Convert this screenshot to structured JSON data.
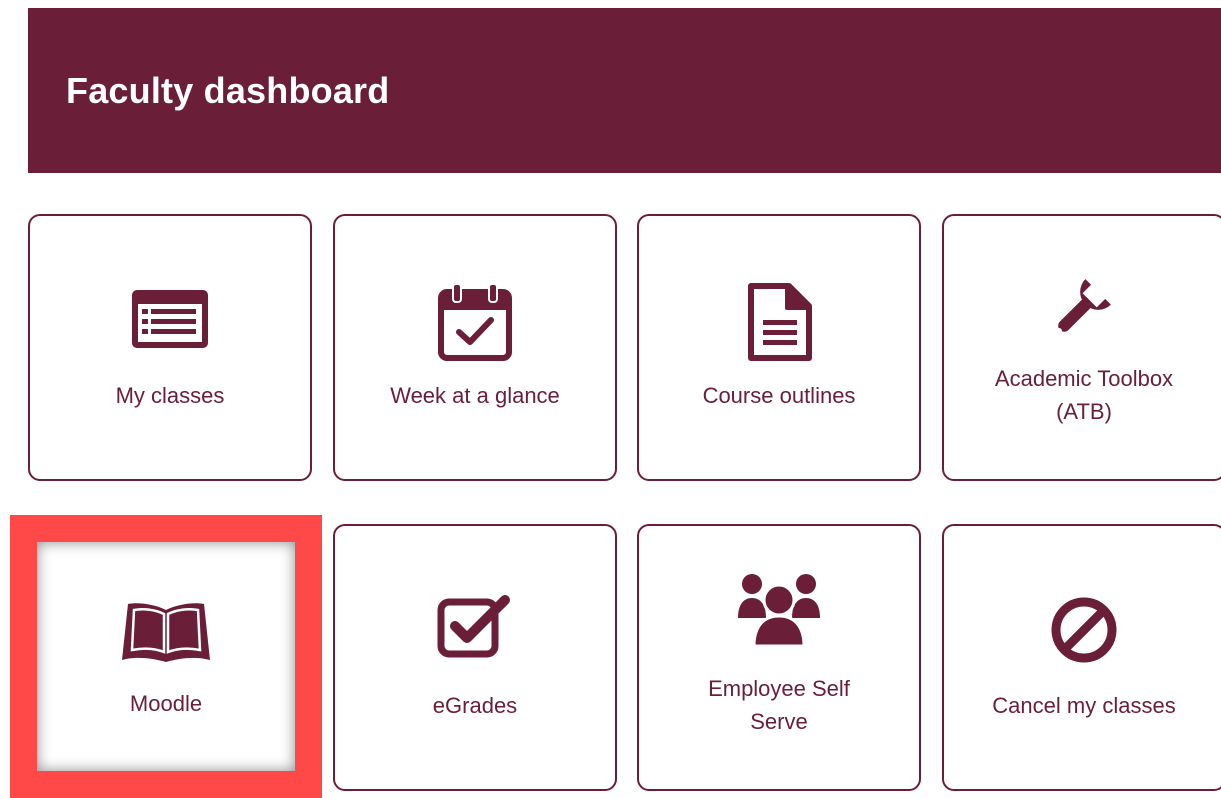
{
  "header": {
    "title": "Faculty dashboard",
    "background_color": "#6a1e37"
  },
  "tiles": [
    {
      "label": "My classes",
      "icon": "list-card-icon"
    },
    {
      "label": "Week at a glance",
      "icon": "calendar-check-icon"
    },
    {
      "label": "Course outlines",
      "icon": "document-icon"
    },
    {
      "label": "Academic Toolbox\n(ATB)",
      "icon": "wrench-icon"
    },
    {
      "label": "Moodle",
      "icon": "open-book-icon",
      "highlighted": true
    },
    {
      "label": "eGrades",
      "icon": "checkbox-icon"
    },
    {
      "label": "Employee Self\nServe",
      "icon": "people-group-icon"
    },
    {
      "label": "Cancel my classes",
      "icon": "prohibited-icon"
    }
  ],
  "colors": {
    "accent": "#6a1e37",
    "highlight": "#ff4848"
  }
}
